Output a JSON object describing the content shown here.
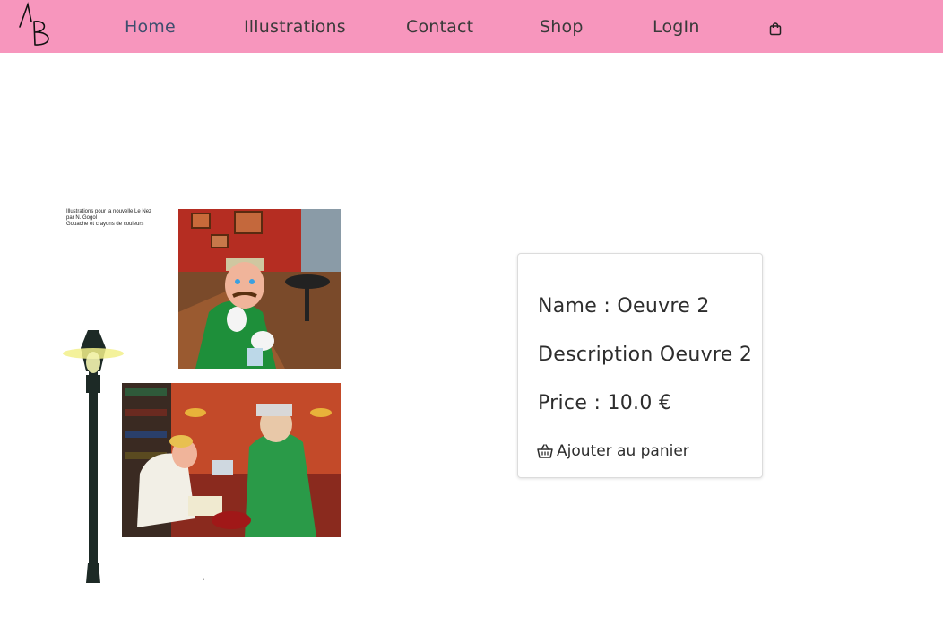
{
  "brand": {
    "logo_text": "AB"
  },
  "nav": {
    "items": [
      {
        "label": "Home",
        "active": true
      },
      {
        "label": "Illustrations",
        "active": false
      },
      {
        "label": "Contact",
        "active": false
      },
      {
        "label": "Shop",
        "active": false
      },
      {
        "label": "LogIn",
        "active": false
      }
    ],
    "cart_icon": "shopping-bag-icon"
  },
  "artwork": {
    "caption_lines": [
      "Illustrations pour la nouvelle Le Nez",
      "par N. Gogol",
      "Gouache et crayons de couleurs"
    ],
    "page_number": "6"
  },
  "product": {
    "name_line": "Name : Oeuvre 2",
    "description_line": "Description Oeuvre 2",
    "price_line": "Price : 10.0 €",
    "add_to_cart_label": "Ajouter au panier",
    "add_to_cart_icon": "basket-icon"
  },
  "colors": {
    "navbar_bg": "#f796bd",
    "active_link": "#3e4e6e",
    "text": "#2d2d2d"
  }
}
